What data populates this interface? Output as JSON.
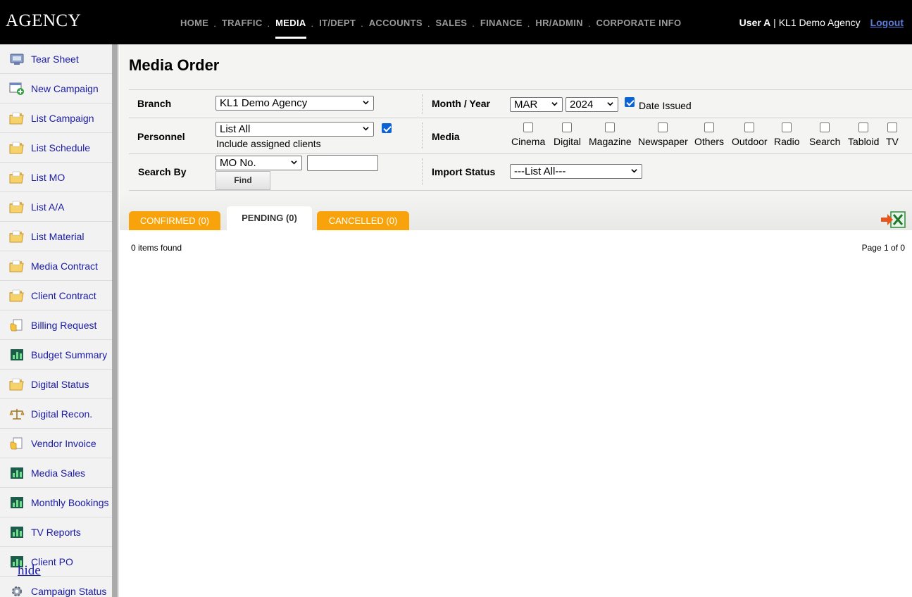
{
  "header": {
    "logo": "AGENCY",
    "nav": [
      "HOME",
      "TRAFFIC",
      "MEDIA",
      "IT/DEPT",
      "ACCOUNTS",
      "SALES",
      "FINANCE",
      "HR/ADMIN",
      "CORPORATE INFO"
    ],
    "active_nav": "MEDIA",
    "user_name": "User A",
    "user_sep": " | ",
    "agency": "KL1 Demo Agency",
    "logout": "Logout"
  },
  "sidebar": {
    "items": [
      {
        "label": "Tear Sheet",
        "icon": "monitor-icon"
      },
      {
        "label": "New Campaign",
        "icon": "add-window-icon"
      },
      {
        "label": "List Campaign",
        "icon": "folder-icon"
      },
      {
        "label": "List Schedule",
        "icon": "folder-icon"
      },
      {
        "label": "List MO",
        "icon": "folder-icon"
      },
      {
        "label": "List A/A",
        "icon": "folder-icon"
      },
      {
        "label": "List Material",
        "icon": "folder-icon"
      },
      {
        "label": "Media Contract",
        "icon": "folder-icon"
      },
      {
        "label": "Client Contract",
        "icon": "folder-icon"
      },
      {
        "label": "Billing Request",
        "icon": "document-hand-icon"
      },
      {
        "label": "Budget Summary",
        "icon": "bar-chart-icon"
      },
      {
        "label": "Digital Status",
        "icon": "folder-icon"
      },
      {
        "label": "Digital Recon.",
        "icon": "scales-icon"
      },
      {
        "label": "Vendor Invoice",
        "icon": "document-hand-icon"
      },
      {
        "label": "Media Sales",
        "icon": "bar-chart-icon"
      },
      {
        "label": "Monthly Bookings",
        "icon": "bar-chart-icon"
      },
      {
        "label": "TV Reports",
        "icon": "bar-chart-icon"
      },
      {
        "label": "Client PO",
        "icon": "bar-chart-icon"
      },
      {
        "label": "Campaign Status",
        "icon": "gear-icon"
      }
    ],
    "hide_label": "hide"
  },
  "main": {
    "title": "Media Order",
    "branch": {
      "label": "Branch",
      "value": "KL1 Demo Agency"
    },
    "month_year": {
      "label": "Month / Year",
      "month": "MAR",
      "year": "2024",
      "date_issued_label": "Date Issued",
      "date_issued_checked": true
    },
    "personnel": {
      "label": "Personnel",
      "value": "List All",
      "include_label": "Include assigned clients",
      "include_checked": true
    },
    "media": {
      "label": "Media",
      "options": [
        "Cinema",
        "Digital",
        "Magazine",
        "Newspaper",
        "Others",
        "Outdoor",
        "Radio",
        "Search",
        "Tabloid",
        "TV"
      ]
    },
    "search_by": {
      "label": "Search By",
      "value": "MO No.",
      "text": "",
      "find_label": "Find"
    },
    "import_status": {
      "label": "Import Status",
      "value": "---List All---"
    },
    "tabs": [
      {
        "label": "CONFIRMED (0)",
        "style": "orange"
      },
      {
        "label": "PENDING (0)",
        "style": "active"
      },
      {
        "label": "CANCELLED (0)",
        "style": "orange"
      }
    ],
    "items_found": "0 items found",
    "page_info": "Page 1 of 0"
  },
  "colors": {
    "tab_orange": "#f8a30c",
    "link_blue": "#1a1aa6",
    "checkbox_blue": "#0b63d6",
    "logout_blue": "#5b7bd8"
  }
}
